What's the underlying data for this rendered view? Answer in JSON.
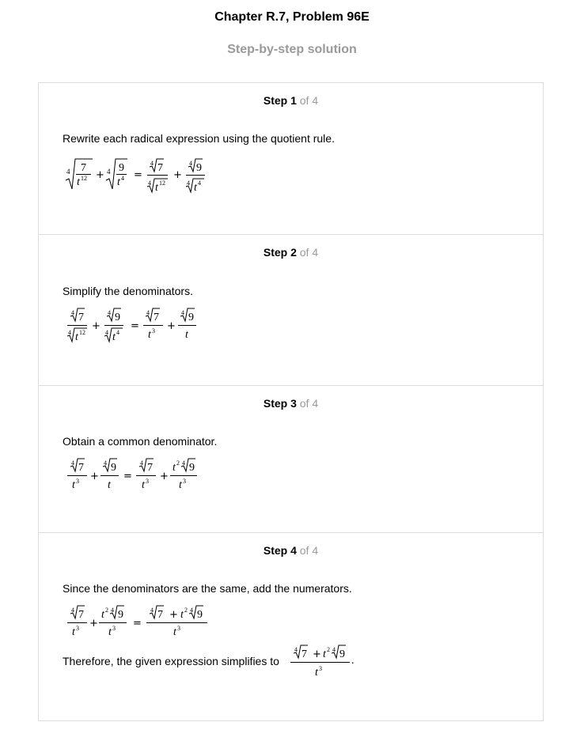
{
  "header": {
    "title": "Chapter R.7, Problem 96E",
    "subtitle": "Step-by-step solution"
  },
  "steps": [
    {
      "label": "Step 1",
      "of": " of 4",
      "text": "Rewrite each radical expression using the quotient rule."
    },
    {
      "label": "Step 2",
      "of": " of 4",
      "text": "Simplify the denominators."
    },
    {
      "label": "Step 3",
      "of": " of 4",
      "text": "Obtain a common denominator."
    },
    {
      "label": "Step 4",
      "of": " of 4",
      "text": "Since the denominators are the same, add the numerators.",
      "conclusion": "Therefore, the given expression simplifies to"
    }
  ],
  "math": {
    "index": "4",
    "seven": "7",
    "nine": "9",
    "t": "t",
    "exp12": "12",
    "exp4": "4",
    "exp3": "3",
    "exp2": "2",
    "plus": "+",
    "equals": "=",
    "period": "."
  }
}
